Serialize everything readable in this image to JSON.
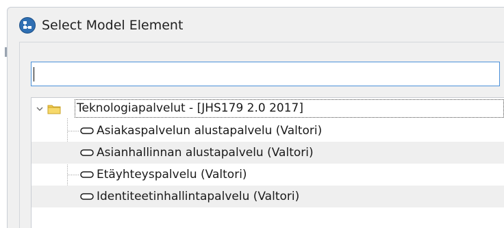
{
  "dialog": {
    "title": "Select Model Element"
  },
  "search": {
    "value": ""
  },
  "tree": {
    "root": {
      "label": "Teknologiapalvelut - [JHS179 2.0 2017]",
      "expanded": true
    },
    "children": [
      {
        "label": "Asiakaspalvelun alustapalvelu (Valtori)"
      },
      {
        "label": "Asianhallinnan alustapalvelu (Valtori)"
      },
      {
        "label": "Etäyhteyspalvelu (Valtori)"
      },
      {
        "label": "Identiteetinhallintapalvelu (Valtori)"
      }
    ]
  },
  "icons": {
    "title": "model-element-dialog-icon",
    "expander": "chevron-down-icon",
    "folder": "folder-icon",
    "element": "technology-service-icon"
  },
  "colors": {
    "search_border": "#4a90d9",
    "folder": "#f2c94c",
    "row_alt": "#efefef"
  }
}
